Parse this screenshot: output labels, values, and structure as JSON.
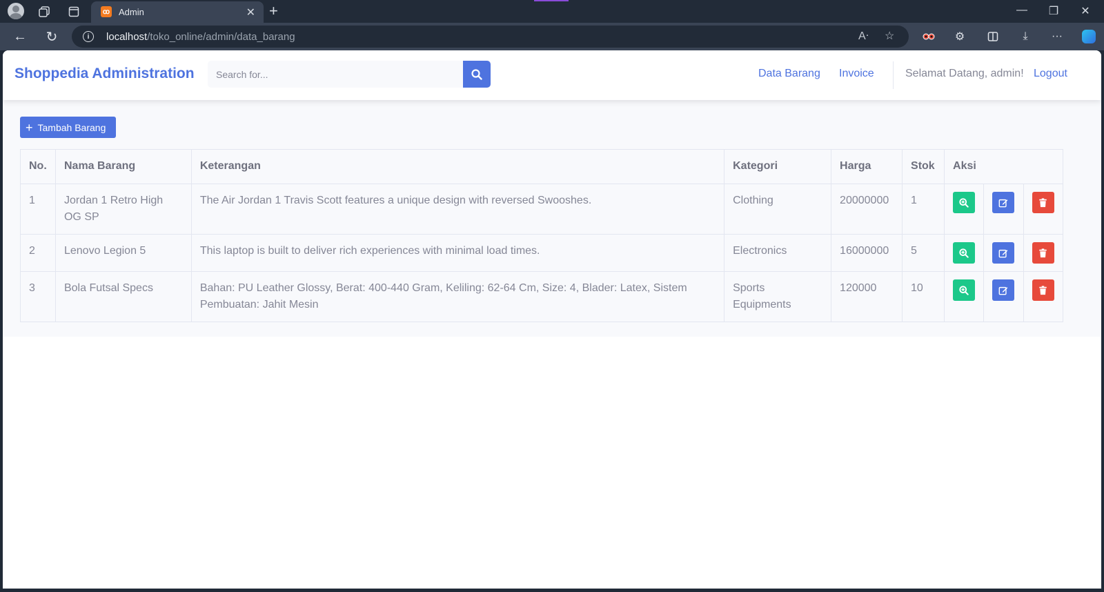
{
  "browser": {
    "tab_title": "Admin",
    "tab_favicon": "XAMPP",
    "url_host": "localhost",
    "url_path": "/toko_online/admin/data_barang"
  },
  "navbar": {
    "brand": "Shoppedia Administration",
    "search_placeholder": "Search for...",
    "links": [
      "Data Barang",
      "Invoice"
    ],
    "welcome": "Selamat Datang, admin!",
    "logout": "Logout"
  },
  "actions": {
    "add_label": "Tambah Barang"
  },
  "table": {
    "headers": [
      "No.",
      "Nama Barang",
      "Keterangan",
      "Kategori",
      "Harga",
      "Stok",
      "Aksi"
    ],
    "rows": [
      {
        "no": "1",
        "nama": "Jordan 1 Retro High OG SP",
        "keterangan": "The Air Jordan 1 Travis Scott features a unique design with reversed Swooshes.",
        "kategori": "Clothing",
        "harga": "20000000",
        "stok": "1"
      },
      {
        "no": "2",
        "nama": "Lenovo Legion 5",
        "keterangan": "This laptop is built to deliver rich experiences with minimal load times.",
        "kategori": "Electronics",
        "harga": "16000000",
        "stok": "5"
      },
      {
        "no": "3",
        "nama": "Bola Futsal Specs",
        "keterangan": "Bahan: PU Leather Glossy, Berat: 400-440 Gram, Keliling: 62-64 Cm, Size: 4, Blader: Latex, Sistem Pembuatan: Jahit Mesin",
        "kategori": "Sports Equipments",
        "harga": "120000",
        "stok": "10"
      }
    ]
  },
  "colors": {
    "primary": "#4e73df",
    "success": "#1cc88a",
    "danger": "#e74a3b",
    "text_muted": "#858796"
  },
  "icons": {
    "view": "search-plus-icon",
    "edit": "edit-icon",
    "delete": "trash-icon"
  }
}
